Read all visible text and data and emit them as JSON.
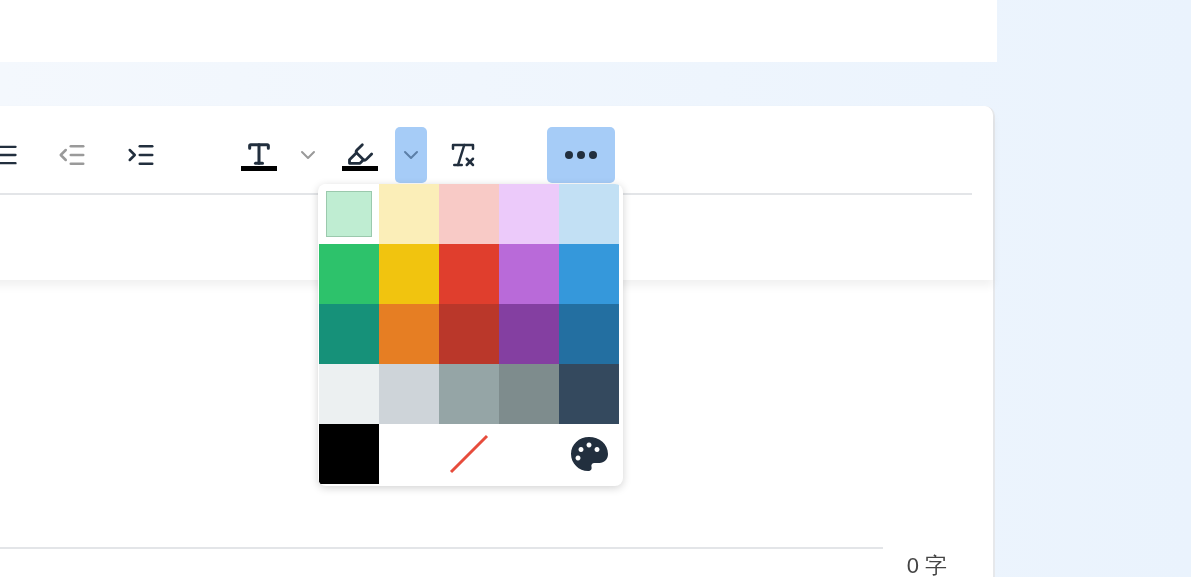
{
  "toolbar": {
    "items": [
      {
        "kind": "list",
        "disabled": false
      },
      {
        "kind": "outdent",
        "disabled": true
      },
      {
        "kind": "indent",
        "disabled": false
      },
      {
        "kind": "font-color",
        "color": "#000000"
      },
      {
        "kind": "caret",
        "expanded": false
      },
      {
        "kind": "highlight",
        "color": "#000000"
      },
      {
        "kind": "caret",
        "expanded": true
      },
      {
        "kind": "clear-format",
        "disabled": false
      },
      {
        "kind": "more",
        "active": true
      }
    ]
  },
  "color_picker": {
    "swatches": [
      {
        "kind": "color",
        "color": "#bfedd2",
        "selected": true
      },
      {
        "kind": "color",
        "color": "#fbeeb8",
        "selected": false
      },
      {
        "kind": "color",
        "color": "#f8cac6",
        "selected": false
      },
      {
        "kind": "color",
        "color": "#eccafa",
        "selected": false
      },
      {
        "kind": "color",
        "color": "#c2e0f4",
        "selected": false
      },
      {
        "kind": "color",
        "color": "#2dc26b",
        "selected": false
      },
      {
        "kind": "color",
        "color": "#f1c40f",
        "selected": false
      },
      {
        "kind": "color",
        "color": "#e03e2d",
        "selected": false
      },
      {
        "kind": "color",
        "color": "#b96ad9",
        "selected": false
      },
      {
        "kind": "color",
        "color": "#3598db",
        "selected": false
      },
      {
        "kind": "color",
        "color": "#169179",
        "selected": false
      },
      {
        "kind": "color",
        "color": "#e67e23",
        "selected": false
      },
      {
        "kind": "color",
        "color": "#ba372a",
        "selected": false
      },
      {
        "kind": "color",
        "color": "#843fa1",
        "selected": false
      },
      {
        "kind": "color",
        "color": "#236fa1",
        "selected": false
      },
      {
        "kind": "color",
        "color": "#ecf0f1",
        "selected": false
      },
      {
        "kind": "color",
        "color": "#ced4d9",
        "selected": false
      },
      {
        "kind": "color",
        "color": "#95a5a6",
        "selected": false
      },
      {
        "kind": "color",
        "color": "#7e8c8d",
        "selected": false
      },
      {
        "kind": "color",
        "color": "#34495e",
        "selected": false
      },
      {
        "kind": "color",
        "color": "#000000",
        "selected": false
      },
      {
        "kind": "remove",
        "selected": false
      },
      {
        "kind": "custom",
        "selected": false
      }
    ]
  },
  "status_bar": {
    "word_count": "0 字"
  }
}
